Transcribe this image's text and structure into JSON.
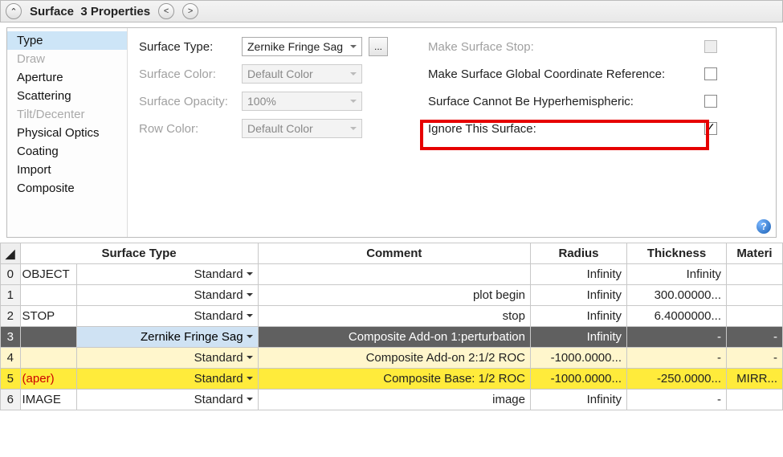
{
  "header": {
    "title": "Surface",
    "subtitle": "3 Properties"
  },
  "nav": {
    "items": [
      "Type",
      "Draw",
      "Aperture",
      "Scattering",
      "Tilt/Decenter",
      "Physical Optics",
      "Coating",
      "Import",
      "Composite"
    ],
    "selected": "Type",
    "disabled": [
      "Draw",
      "Tilt/Decenter"
    ]
  },
  "form": {
    "surface_type_label": "Surface Type:",
    "surface_type_value": "Zernike Fringe Sag",
    "surface_color_label": "Surface Color:",
    "surface_color_value": "Default Color",
    "surface_opacity_label": "Surface Opacity:",
    "surface_opacity_value": "100%",
    "row_color_label": "Row Color:",
    "row_color_value": "Default Color",
    "right": {
      "make_stop": "Make Surface Stop:",
      "make_global": "Make Surface Global Coordinate Reference:",
      "hyper": "Surface Cannot Be Hyperhemispheric:",
      "ignore": "Ignore This Surface:"
    }
  },
  "table": {
    "headers": [
      "Surface Type",
      "Comment",
      "Radius",
      "Thickness",
      "Materi"
    ],
    "rows": [
      {
        "n": "0",
        "obj": "OBJECT",
        "stype": "Standard",
        "comment": "",
        "radius": "Infinity",
        "thick": "Infinity",
        "mat": ""
      },
      {
        "n": "1",
        "obj": "",
        "stype": "Standard",
        "comment": "plot begin",
        "radius": "Infinity",
        "thick": "300.00000...",
        "mat": ""
      },
      {
        "n": "2",
        "obj": "STOP",
        "stype": "Standard",
        "comment": "stop",
        "radius": "Infinity",
        "thick": "6.4000000...",
        "mat": ""
      },
      {
        "n": "3",
        "obj": "",
        "stype": "Zernike Fringe Sag",
        "comment": "Composite Add-on 1:perturbation",
        "radius": "Infinity",
        "thick": "-",
        "mat": "-"
      },
      {
        "n": "4",
        "obj": "",
        "stype": "Standard",
        "comment": "Composite Add-on 2:1/2 ROC",
        "radius": "-1000.0000...",
        "thick": "-",
        "mat": "-"
      },
      {
        "n": "5",
        "obj": "(aper)",
        "stype": "Standard",
        "comment": "Composite Base: 1/2 ROC",
        "radius": "-1000.0000...",
        "thick": "-250.0000...",
        "mat": "MIRR..."
      },
      {
        "n": "6",
        "obj": "IMAGE",
        "stype": "Standard",
        "comment": "image",
        "radius": "Infinity",
        "thick": "-",
        "mat": ""
      }
    ]
  }
}
